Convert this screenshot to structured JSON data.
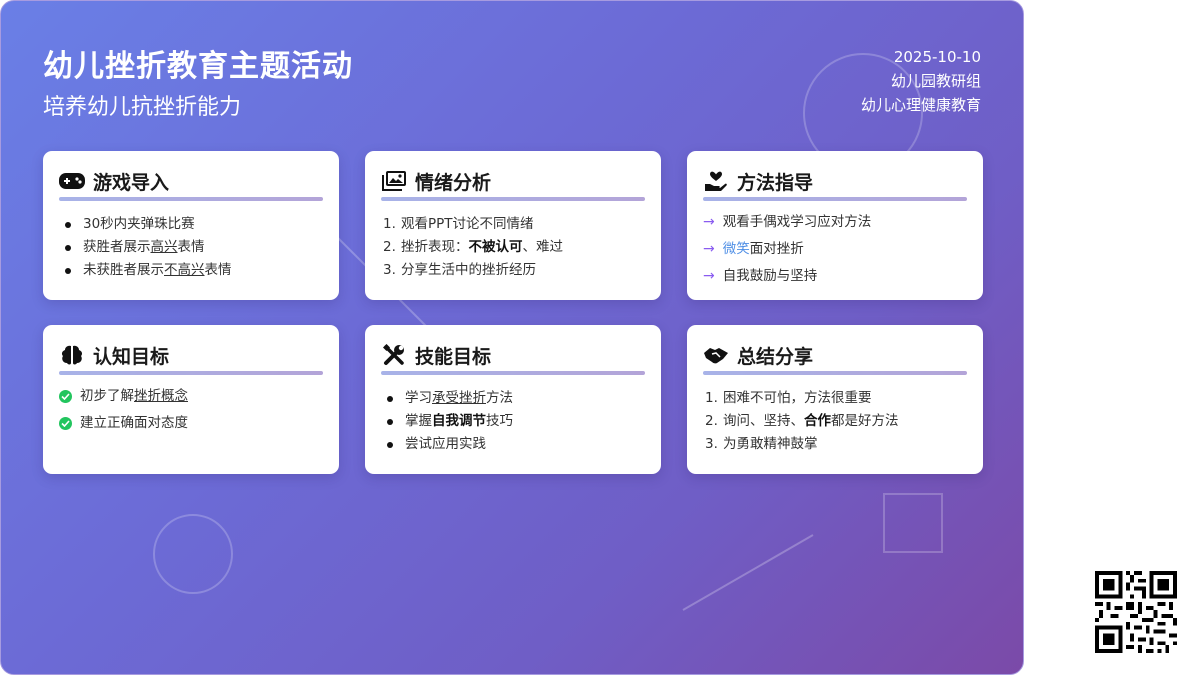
{
  "header": {
    "title": "幼儿挫折教育主题活动",
    "subtitle": "培养幼儿抗挫折能力",
    "date": "2025-10-10",
    "org": "幼儿园教研组",
    "category": "幼儿心理健康教育"
  },
  "cards": [
    {
      "title": "游戏导入",
      "icon": "gamepad-icon",
      "items": [
        {
          "text": "30秒内夹弹珠比赛"
        },
        {
          "pre": "获胜者展示",
          "u": "高兴",
          "post": "表情"
        },
        {
          "pre": "未获胜者展示",
          "u": "不高兴",
          "post": "表情"
        }
      ]
    },
    {
      "title": "情绪分析",
      "icon": "images-icon",
      "items": [
        {
          "num": "1.",
          "text": "观看PPT讨论不同情绪"
        },
        {
          "num": "2.",
          "pre": "挫折表现：",
          "b": "不被认可",
          "post": "、难过"
        },
        {
          "num": "3.",
          "text": "分享生活中的挫折经历"
        }
      ]
    },
    {
      "title": "方法指导",
      "icon": "hand-heart-icon",
      "items": [
        {
          "text": "观看手偶戏学习应对方法"
        },
        {
          "hl": "微笑",
          "post": "面对挫折"
        },
        {
          "text": "自我鼓励与坚持"
        }
      ]
    },
    {
      "title": "认知目标",
      "icon": "brain-icon",
      "items": [
        {
          "pre": "初步了解",
          "u": "挫折概念"
        },
        {
          "text": "建立正确面对态度"
        }
      ]
    },
    {
      "title": "技能目标",
      "icon": "tools-icon",
      "items": [
        {
          "pre": "学习",
          "u": "承受挫折",
          "post": "方法"
        },
        {
          "pre": "掌握",
          "b": "自我调节",
          "post": "技巧"
        },
        {
          "text": "尝试应用实践"
        }
      ]
    },
    {
      "title": "总结分享",
      "icon": "handshake-icon",
      "items": [
        {
          "num": "1.",
          "text": "困难不可怕，方法很重要"
        },
        {
          "num": "2.",
          "pre": "询问、坚持、",
          "b": "合作",
          "post": "都是好方法"
        },
        {
          "num": "3.",
          "text": "为勇敢精神鼓掌"
        }
      ]
    }
  ],
  "colors": {
    "accent_arrow": "#8a5cf0",
    "check_green": "#22c55e",
    "highlight_blue": "#4f8fe6"
  }
}
